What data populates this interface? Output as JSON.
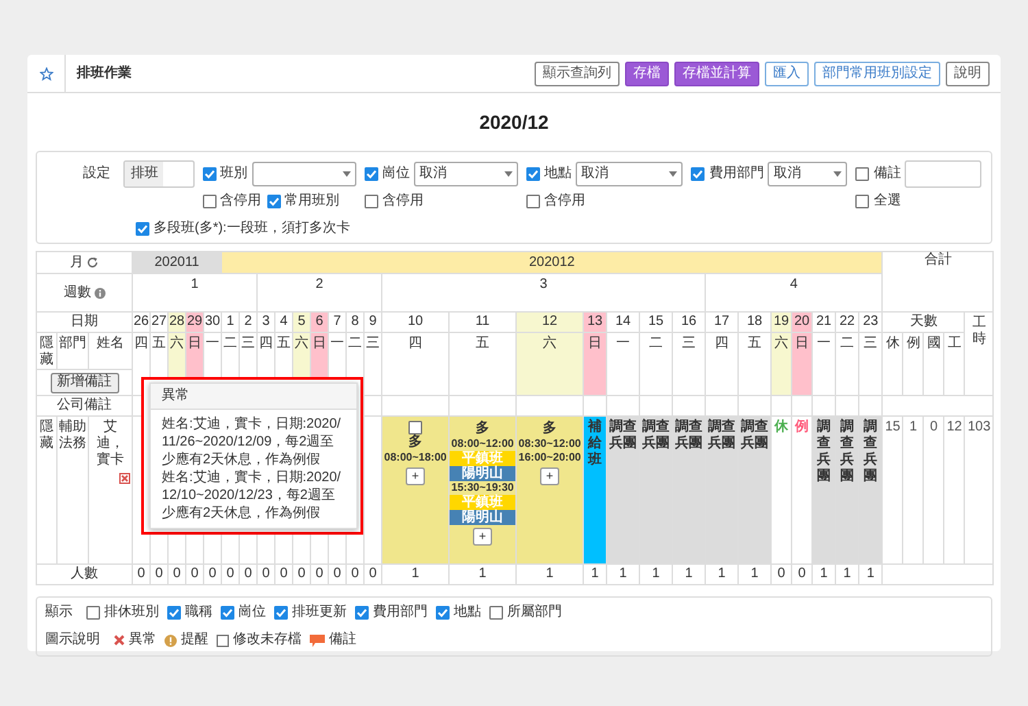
{
  "toolbar": {
    "title": "排班作業",
    "buttons": [
      {
        "label": "顯示查詢列",
        "kind": "default"
      },
      {
        "label": "存檔",
        "kind": "primary"
      },
      {
        "label": "存檔並計算",
        "kind": "primary"
      },
      {
        "label": "匯入",
        "kind": "info"
      },
      {
        "label": "部門常用班別設定",
        "kind": "info"
      },
      {
        "label": "說明",
        "kind": "default"
      }
    ]
  },
  "period": "2020/12",
  "settings": {
    "label": "設定",
    "mode_value": "排班",
    "groups": [
      {
        "kind": "select",
        "label": "班別",
        "checked": true,
        "options": [
          {
            "label": "含停用",
            "checked": false
          },
          {
            "label": "常用班別",
            "checked": true
          }
        ]
      },
      {
        "kind": "select",
        "label": "崗位",
        "checked": true,
        "value": "取消",
        "options": [
          {
            "label": "含停用",
            "checked": false
          }
        ]
      },
      {
        "kind": "select",
        "label": "地點",
        "checked": true,
        "value": "取消",
        "options": [
          {
            "label": "含停用",
            "checked": false
          }
        ]
      },
      {
        "kind": "select",
        "label": "費用部門",
        "checked": true,
        "value": "取消"
      },
      {
        "kind": "input",
        "label": "備註",
        "checked": false,
        "options": [
          {
            "label": "全選",
            "checked": false
          }
        ]
      }
    ],
    "multi_segment": {
      "label": "多段班(多*):一段班，須打多次卡",
      "checked": true
    }
  },
  "table": {
    "month_label": "月",
    "week_label": "週數",
    "date_label": "日期",
    "columns": [
      "隱藏",
      "部門",
      "姓名"
    ],
    "add_note_button": "新增備註",
    "company_note_label": "公司備註",
    "count_label": "人數",
    "total_label": "合計",
    "days_label": "天數",
    "total_columns": [
      "休",
      "例",
      "國",
      "工"
    ],
    "hours_label": "工時",
    "months": [
      {
        "label": "202011",
        "current": false
      },
      {
        "label": "202012",
        "current": true
      }
    ],
    "weeks": [
      {
        "label": "1",
        "days": [
          {
            "date": "26",
            "weekday": "四",
            "kind": "weekday",
            "count": "0"
          },
          {
            "date": "27",
            "weekday": "五",
            "kind": "weekday",
            "count": "0"
          },
          {
            "date": "28",
            "weekday": "六",
            "kind": "saturday",
            "count": "0"
          },
          {
            "date": "29",
            "weekday": "日",
            "kind": "sunday",
            "count": "0"
          },
          {
            "date": "30",
            "weekday": "一",
            "kind": "weekday",
            "count": "0"
          },
          {
            "date": "1",
            "weekday": "二",
            "kind": "weekday",
            "count": "0"
          },
          {
            "date": "2",
            "weekday": "三",
            "kind": "weekday",
            "count": "0"
          }
        ]
      },
      {
        "label": "2",
        "days": [
          {
            "date": "3",
            "weekday": "四",
            "kind": "weekday",
            "count": "0"
          },
          {
            "date": "4",
            "weekday": "五",
            "kind": "weekday",
            "count": "0"
          },
          {
            "date": "5",
            "weekday": "六",
            "kind": "saturday",
            "count": "0"
          },
          {
            "date": "6",
            "weekday": "日",
            "kind": "sunday",
            "count": "0"
          },
          {
            "date": "7",
            "weekday": "一",
            "kind": "weekday",
            "count": "0"
          },
          {
            "date": "8",
            "weekday": "二",
            "kind": "weekday",
            "count": "0"
          },
          {
            "date": "9",
            "weekday": "三",
            "kind": "weekday",
            "count": "0"
          }
        ]
      },
      {
        "label": "3",
        "days": [
          {
            "date": "10",
            "weekday": "四",
            "kind": "weekday",
            "count": "1",
            "shift": {
              "kind": "multi",
              "checked": false,
              "label": "多",
              "segments": [
                {
                  "time": "08:00~18:00"
                }
              ],
              "add": "+"
            }
          },
          {
            "date": "11",
            "weekday": "五",
            "kind": "weekday",
            "count": "1",
            "shift": {
              "kind": "multi",
              "label": "多",
              "segments": [
                {
                  "time": "08:00~12:00",
                  "tags": [
                    {
                      "kind": "shift",
                      "text": "平鎮班"
                    },
                    {
                      "kind": "place",
                      "text": "陽明山"
                    }
                  ]
                },
                {
                  "time": "15:30~19:30",
                  "tags": [
                    {
                      "kind": "shift",
                      "text": "平鎮班"
                    },
                    {
                      "kind": "place",
                      "text": "陽明山"
                    }
                  ]
                }
              ],
              "add": "+"
            }
          },
          {
            "date": "12",
            "weekday": "六",
            "kind": "saturday",
            "count": "1",
            "shift": {
              "kind": "multi",
              "label": "多",
              "segments": [
                {
                  "time": "08:30~12:00"
                },
                {
                  "time": "16:00~20:00"
                }
              ],
              "add": "+"
            }
          },
          {
            "date": "13",
            "weekday": "日",
            "kind": "sunday",
            "count": "1",
            "shift": {
              "kind": "duty",
              "text": "補給班"
            }
          },
          {
            "date": "14",
            "weekday": "一",
            "kind": "weekday",
            "count": "1",
            "shift": {
              "kind": "team",
              "text": "調查兵團"
            }
          },
          {
            "date": "15",
            "weekday": "二",
            "kind": "weekday",
            "count": "1",
            "shift": {
              "kind": "team",
              "text": "調查兵團"
            }
          },
          {
            "date": "16",
            "weekday": "三",
            "kind": "weekday",
            "count": "1",
            "shift": {
              "kind": "team",
              "text": "調查兵團"
            }
          }
        ]
      },
      {
        "label": "4",
        "days": [
          {
            "date": "17",
            "weekday": "四",
            "kind": "weekday",
            "count": "1",
            "shift": {
              "kind": "team",
              "text": "調查兵團"
            }
          },
          {
            "date": "18",
            "weekday": "五",
            "kind": "weekday",
            "count": "1",
            "shift": {
              "kind": "team",
              "text": "調查兵團"
            }
          },
          {
            "date": "19",
            "weekday": "六",
            "kind": "saturday",
            "count": "0",
            "shift": {
              "kind": "rest",
              "text": "休"
            }
          },
          {
            "date": "20",
            "weekday": "日",
            "kind": "sunday",
            "count": "0",
            "shift": {
              "kind": "off",
              "text": "例"
            }
          },
          {
            "date": "21",
            "weekday": "一",
            "kind": "weekday",
            "count": "1",
            "shift": {
              "kind": "team",
              "text": "調查兵團"
            }
          },
          {
            "date": "22",
            "weekday": "二",
            "kind": "weekday",
            "count": "1",
            "shift": {
              "kind": "team",
              "text": "調查兵團"
            }
          },
          {
            "date": "23",
            "weekday": "三",
            "kind": "weekday",
            "count": "1",
            "shift": {
              "kind": "team",
              "text": "調查兵團"
            }
          }
        ]
      }
    ],
    "employees": [
      {
        "hide": "隱藏",
        "department": "輔助法務",
        "name": "艾迪，實卡",
        "alert": true,
        "totals": [
          "15",
          "1",
          "0",
          "12",
          "103"
        ]
      }
    ]
  },
  "tooltip": {
    "title": "異常",
    "lines": [
      "姓名:艾迪，實卡，日期:2020/11/26~2020/12/09，每2週至少應有2天休息，作為例假",
      "姓名:艾迪，實卡，日期:2020/12/10~2020/12/23，每2週至少應有2天休息，作為例假"
    ]
  },
  "display": {
    "label": "顯示",
    "options": [
      {
        "label": "排休班別",
        "checked": false
      },
      {
        "label": "職稱",
        "checked": true
      },
      {
        "label": "崗位",
        "checked": true
      },
      {
        "label": "排班更新",
        "checked": true
      },
      {
        "label": "費用部門",
        "checked": true
      },
      {
        "label": "地點",
        "checked": true
      },
      {
        "label": "所屬部門",
        "checked": false
      }
    ]
  },
  "legend": {
    "label": "圖示說明",
    "items": [
      {
        "kind": "error",
        "label": "異常"
      },
      {
        "kind": "warning",
        "label": "提醒"
      },
      {
        "kind": "unsaved",
        "label": "修改未存檔"
      },
      {
        "kind": "note",
        "label": "備註"
      }
    ]
  }
}
